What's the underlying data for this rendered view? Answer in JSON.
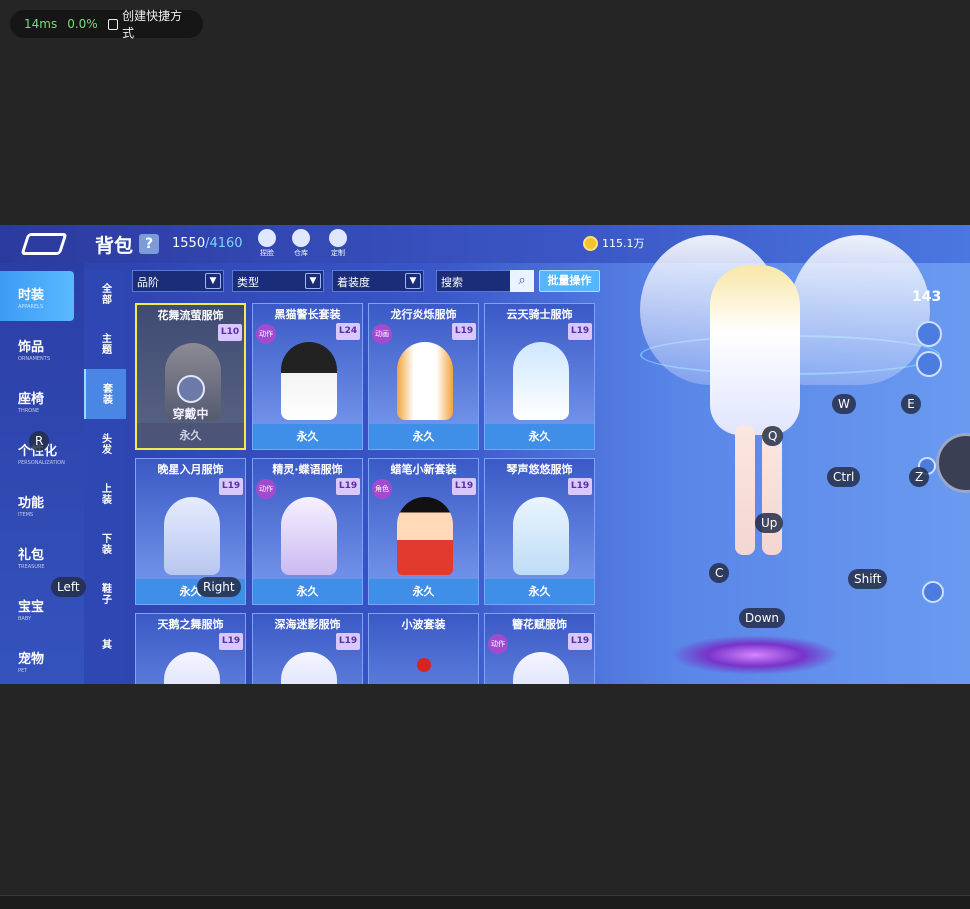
{
  "overlay": {
    "latency": "14ms",
    "loss": "0.0%",
    "shortcut_label": "创建快捷方式"
  },
  "header": {
    "title": "背包",
    "help": "?",
    "capacity_used": "1550",
    "capacity_max": "/4160",
    "tools": [
      {
        "label": "捏脸",
        "icon": "face-icon"
      },
      {
        "label": "仓库",
        "icon": "warehouse-icon"
      },
      {
        "label": "定制",
        "icon": "customize-icon"
      }
    ],
    "coins": "115.1万"
  },
  "sidebar": [
    {
      "cn": "时装",
      "en": "APPARELS",
      "active": true
    },
    {
      "cn": "饰品",
      "en": "ORNAMENTS"
    },
    {
      "cn": "座椅",
      "en": "THRONE"
    },
    {
      "cn": "个性化",
      "en": "PERSONALIZATION"
    },
    {
      "cn": "功能",
      "en": "ITEMS"
    },
    {
      "cn": "礼包",
      "en": "TREASURE"
    },
    {
      "cn": "宝宝",
      "en": "BABY"
    },
    {
      "cn": "宠物",
      "en": "PET"
    }
  ],
  "subtabs": [
    "全部",
    "主题",
    "套装",
    "头发",
    "上装",
    "下装",
    "鞋子",
    "其"
  ],
  "filters": {
    "grade": "品阶",
    "type": "类型",
    "wear": "着装度",
    "search": "搜索",
    "batch": "批量操作"
  },
  "items": [
    {
      "name": "花舞流萤服饰",
      "level": "L10",
      "duration": "永久",
      "wearing": "穿戴中"
    },
    {
      "name": "黑猫警长套装",
      "level": "L24",
      "duration": "永久",
      "tag": "动作"
    },
    {
      "name": "龙行炎烁服饰",
      "level": "L19",
      "duration": "永久",
      "tag": "动画"
    },
    {
      "name": "云天骑士服饰",
      "level": "L19",
      "duration": "永久"
    },
    {
      "name": "晚星入月服饰",
      "level": "L19",
      "duration": "永久"
    },
    {
      "name": "精灵·蝶语服饰",
      "level": "L19",
      "duration": "永久",
      "tag": "动作"
    },
    {
      "name": "蜡笔小新套装",
      "level": "L19",
      "duration": "永久",
      "tag": "角色"
    },
    {
      "name": "琴声悠悠服饰",
      "level": "L19",
      "duration": "永久"
    },
    {
      "name": "天鹅之舞服饰",
      "level": "L19",
      "duration": ""
    },
    {
      "name": "深海迷影服饰",
      "level": "L19",
      "duration": ""
    },
    {
      "name": "小波套装",
      "level": "",
      "duration": ""
    },
    {
      "name": "簪花赋服饰",
      "level": "L19",
      "duration": "",
      "tag": "动作"
    }
  ],
  "scene": {
    "level": "143"
  },
  "keys": {
    "R": "R",
    "Left": "Left",
    "Right": "Right",
    "W": "W",
    "E": "E",
    "Q": "Q",
    "Ctrl": "Ctrl",
    "Z": "Z",
    "Up": "Up",
    "C": "C",
    "Shift": "Shift",
    "Down": "Down"
  }
}
